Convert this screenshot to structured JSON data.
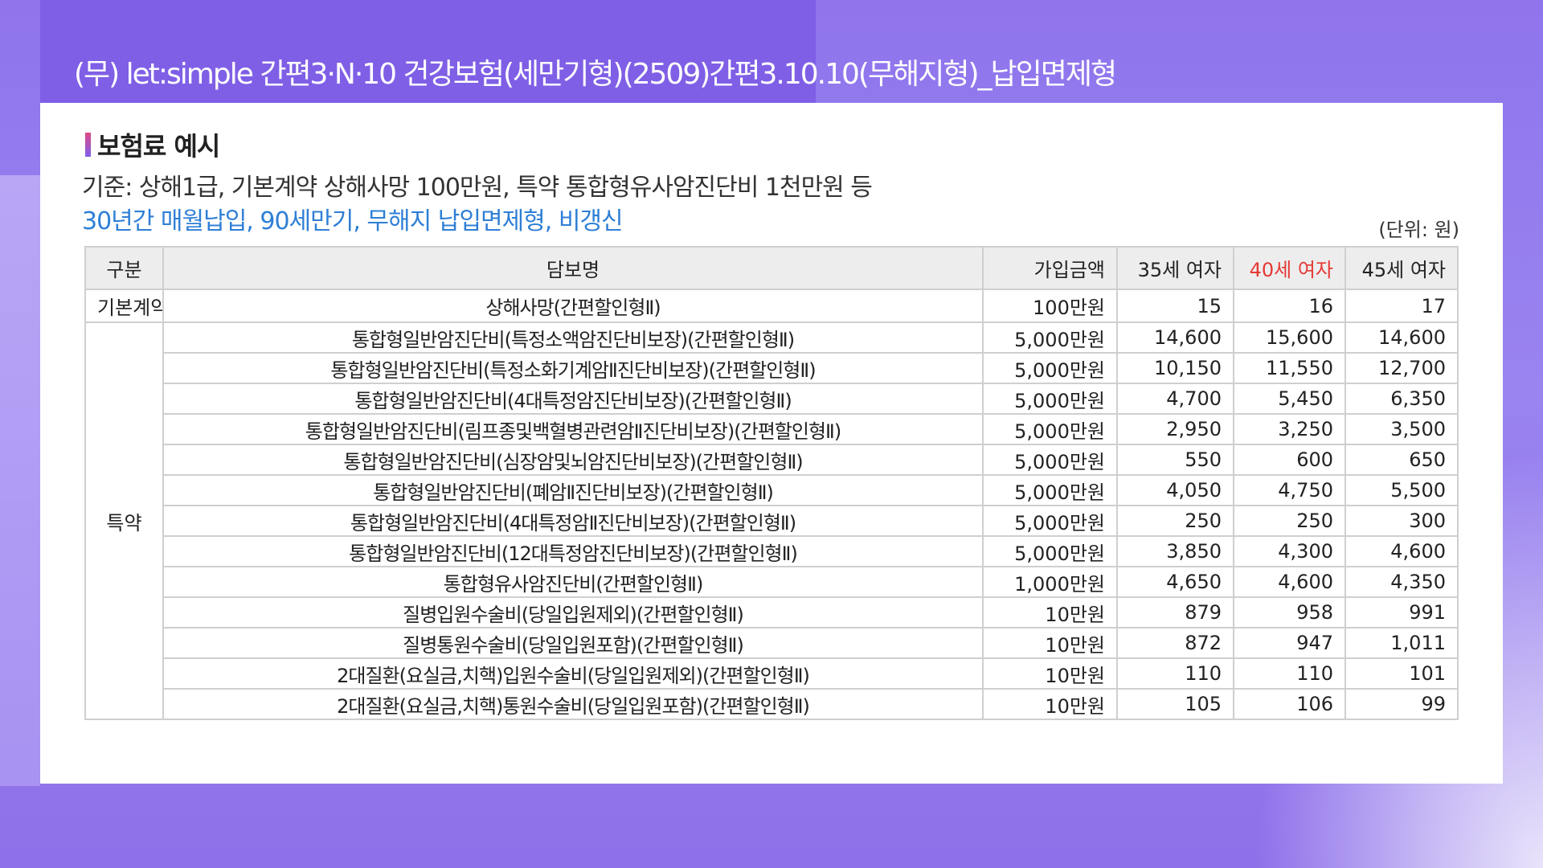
{
  "header": {
    "title": "(무) let:simple 간편3·N·10 건강보험(세만기형)(2509)간편3.10.10(무해지형)_납입면제형"
  },
  "section": {
    "title": "보험료 예시",
    "basis": "기준: 상해1급, 기본계약 상해사망 100만원, 특약 통합형유사암진단비 1천만원 등",
    "conditions": "30년간 매월납입, 90세만기, 무해지 납입면제형, 비갱신",
    "unit": "(단위: 원)"
  },
  "colors": {
    "accent": "#7f5fe6",
    "highlight_blue": "#2f7fd6",
    "highlight_red": "#e53935"
  },
  "table": {
    "headers": {
      "category": "구분",
      "coverage": "담보명",
      "amount": "가입금액",
      "age35": "35세 여자",
      "age40": "40세 여자",
      "age45": "45세 여자"
    },
    "categories": {
      "basic": "기본계약",
      "rider": "특약"
    },
    "rows": [
      {
        "name": "상해사망(간편할인형Ⅱ)",
        "amount": "100만원",
        "age35": "15",
        "age40": "16",
        "age45": "17"
      },
      {
        "name": "통합형일반암진단비(특정소액암진단비보장)(간편할인형Ⅱ)",
        "amount": "5,000만원",
        "age35": "14,600",
        "age40": "15,600",
        "age45": "14,600"
      },
      {
        "name": "통합형일반암진단비(특정소화기계암Ⅱ진단비보장)(간편할인형Ⅱ)",
        "amount": "5,000만원",
        "age35": "10,150",
        "age40": "11,550",
        "age45": "12,700"
      },
      {
        "name": "통합형일반암진단비(4대특정암진단비보장)(간편할인형Ⅱ)",
        "amount": "5,000만원",
        "age35": "4,700",
        "age40": "5,450",
        "age45": "6,350"
      },
      {
        "name": "통합형일반암진단비(림프종및백혈병관련암Ⅱ진단비보장)(간편할인형Ⅱ)",
        "amount": "5,000만원",
        "age35": "2,950",
        "age40": "3,250",
        "age45": "3,500"
      },
      {
        "name": "통합형일반암진단비(심장암및뇌암진단비보장)(간편할인형Ⅱ)",
        "amount": "5,000만원",
        "age35": "550",
        "age40": "600",
        "age45": "650"
      },
      {
        "name": "통합형일반암진단비(폐암Ⅱ진단비보장)(간편할인형Ⅱ)",
        "amount": "5,000만원",
        "age35": "4,050",
        "age40": "4,750",
        "age45": "5,500"
      },
      {
        "name": "통합형일반암진단비(4대특정암Ⅱ진단비보장)(간편할인형Ⅱ)",
        "amount": "5,000만원",
        "age35": "250",
        "age40": "250",
        "age45": "300"
      },
      {
        "name": "통합형일반암진단비(12대특정암진단비보장)(간편할인형Ⅱ)",
        "amount": "5,000만원",
        "age35": "3,850",
        "age40": "4,300",
        "age45": "4,600"
      },
      {
        "name": "통합형유사암진단비(간편할인형Ⅱ)",
        "amount": "1,000만원",
        "age35": "4,650",
        "age40": "4,600",
        "age45": "4,350"
      },
      {
        "name": "질병입원수술비(당일입원제외)(간편할인형Ⅱ)",
        "amount": "10만원",
        "age35": "879",
        "age40": "958",
        "age45": "991"
      },
      {
        "name": "질병통원수술비(당일입원포함)(간편할인형Ⅱ)",
        "amount": "10만원",
        "age35": "872",
        "age40": "947",
        "age45": "1,011"
      },
      {
        "name": "2대질환(요실금,치핵)입원수술비(당일입원제외)(간편할인형Ⅱ)",
        "amount": "10만원",
        "age35": "110",
        "age40": "110",
        "age45": "101"
      },
      {
        "name": "2대질환(요실금,치핵)통원수술비(당일입원포함)(간편할인형Ⅱ)",
        "amount": "10만원",
        "age35": "105",
        "age40": "106",
        "age45": "99"
      }
    ]
  }
}
